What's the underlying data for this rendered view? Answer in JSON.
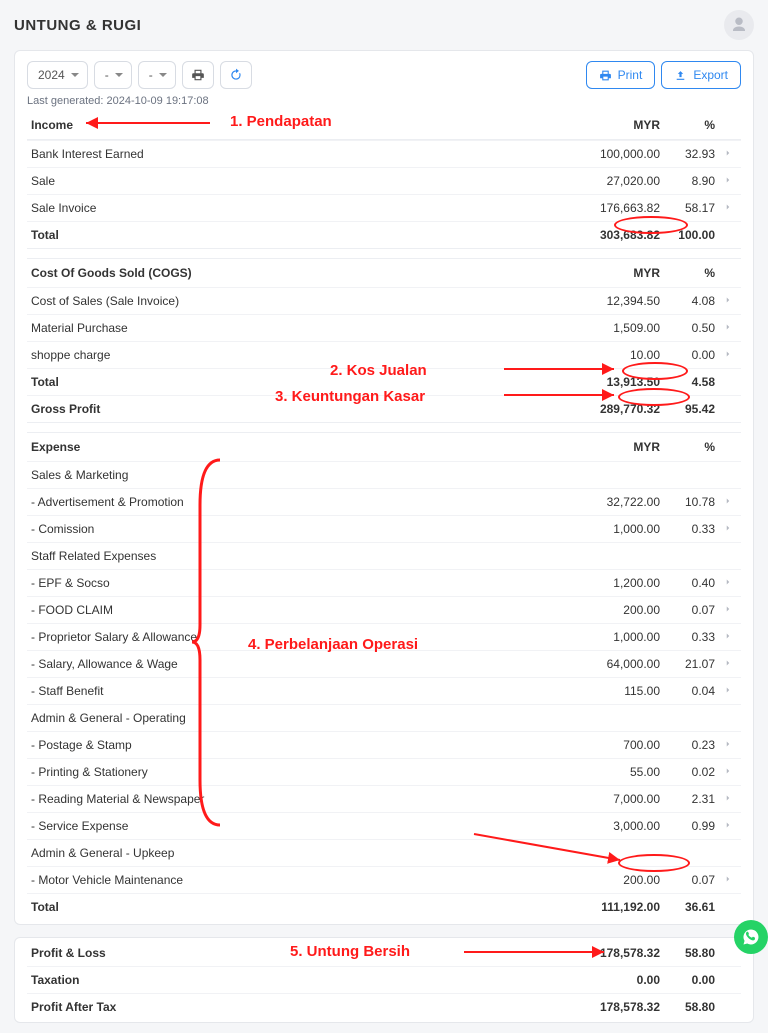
{
  "header": {
    "title": "UNTUNG & RUGI"
  },
  "toolbar": {
    "year": "2024",
    "month": "-",
    "compare": "-",
    "print_label": "Print",
    "export_label": "Export"
  },
  "generated": "Last generated: 2024-10-09 19:17:08",
  "columns": {
    "amount": "MYR",
    "percent": "%"
  },
  "income": {
    "title": "Income",
    "rows": [
      {
        "label": "Bank Interest Earned",
        "amount": "100,000.00",
        "percent": "32.93"
      },
      {
        "label": "Sale",
        "amount": "27,020.00",
        "percent": "8.90"
      },
      {
        "label": "Sale Invoice",
        "amount": "176,663.82",
        "percent": "58.17"
      }
    ],
    "total_label": "Total",
    "total_amount": "303,683.82",
    "total_percent": "100.00"
  },
  "cogs": {
    "title": "Cost Of Goods Sold (COGS)",
    "rows": [
      {
        "label": "Cost of Sales (Sale Invoice)",
        "amount": "12,394.50",
        "percent": "4.08"
      },
      {
        "label": "Material Purchase",
        "amount": "1,509.00",
        "percent": "0.50"
      },
      {
        "label": "shoppe charge",
        "amount": "10.00",
        "percent": "0.00"
      }
    ],
    "total_label": "Total",
    "total_amount": "13,913.50",
    "total_percent": "4.58",
    "gross_profit_label": "Gross Profit",
    "gross_profit_amount": "289,770.32",
    "gross_profit_percent": "95.42"
  },
  "expense": {
    "title": "Expense",
    "groups": [
      {
        "heading": "Sales & Marketing",
        "rows": [
          {
            "label": "- Advertisement & Promotion",
            "amount": "32,722.00",
            "percent": "10.78"
          },
          {
            "label": "- Comission",
            "amount": "1,000.00",
            "percent": "0.33"
          }
        ]
      },
      {
        "heading": "Staff Related Expenses",
        "rows": [
          {
            "label": "- EPF & Socso",
            "amount": "1,200.00",
            "percent": "0.40"
          },
          {
            "label": "- FOOD CLAIM",
            "amount": "200.00",
            "percent": "0.07"
          },
          {
            "label": "- Proprietor Salary & Allowance",
            "amount": "1,000.00",
            "percent": "0.33"
          },
          {
            "label": "- Salary, Allowance & Wage",
            "amount": "64,000.00",
            "percent": "21.07"
          },
          {
            "label": "- Staff Benefit",
            "amount": "115.00",
            "percent": "0.04"
          }
        ]
      },
      {
        "heading": "Admin & General - Operating",
        "rows": [
          {
            "label": "- Postage & Stamp",
            "amount": "700.00",
            "percent": "0.23"
          },
          {
            "label": "- Printing & Stationery",
            "amount": "55.00",
            "percent": "0.02"
          },
          {
            "label": "- Reading Material & Newspaper",
            "amount": "7,000.00",
            "percent": "2.31"
          },
          {
            "label": "- Service Expense",
            "amount": "3,000.00",
            "percent": "0.99"
          }
        ]
      },
      {
        "heading": "Admin & General - Upkeep",
        "rows": [
          {
            "label": "- Motor Vehicle Maintenance",
            "amount": "200.00",
            "percent": "0.07"
          }
        ]
      }
    ],
    "total_label": "Total",
    "total_amount": "111,192.00",
    "total_percent": "36.61"
  },
  "summary": {
    "rows": [
      {
        "label": "Profit & Loss",
        "amount": "178,578.32",
        "percent": "58.80"
      },
      {
        "label": "Taxation",
        "amount": "0.00",
        "percent": "0.00"
      },
      {
        "label": "Profit After Tax",
        "amount": "178,578.32",
        "percent": "58.80"
      }
    ]
  },
  "annotations": {
    "a1": "1. Pendapatan",
    "a2": "2. Kos Jualan",
    "a3": "3. Keuntungan Kasar",
    "a4": "4. Perbelanjaan Operasi",
    "a5": "5. Untung Bersih"
  }
}
